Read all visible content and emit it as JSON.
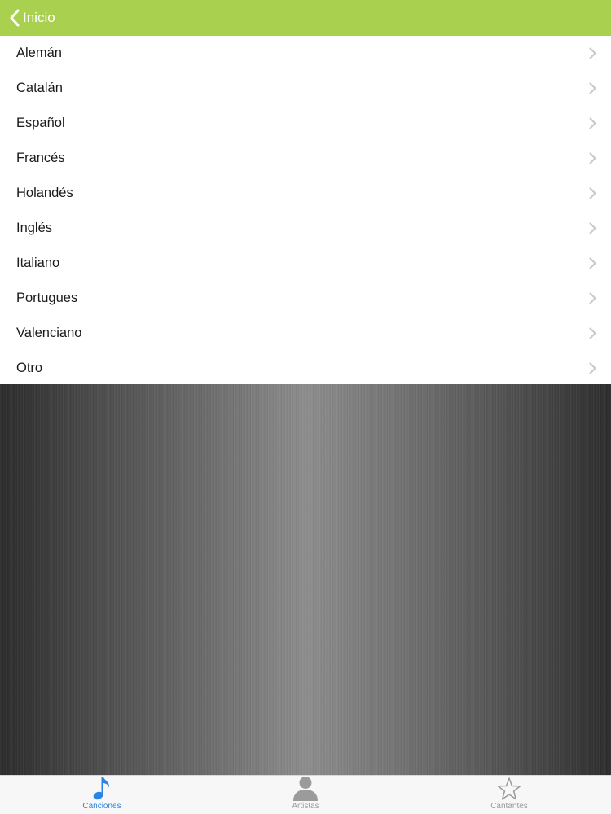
{
  "navbar": {
    "back_label": "Inicio",
    "back_icon": "chevron-left-icon",
    "background": "#a9d04f"
  },
  "languages": [
    {
      "label": "Alemán"
    },
    {
      "label": "Catalán"
    },
    {
      "label": "Español"
    },
    {
      "label": "Francés"
    },
    {
      "label": "Holandés"
    },
    {
      "label": "Inglés"
    },
    {
      "label": "Italiano"
    },
    {
      "label": "Portugues"
    },
    {
      "label": "Valenciano"
    },
    {
      "label": "Otro"
    }
  ],
  "row_icon": "chevron-right-icon",
  "tabbar": {
    "tabs": [
      {
        "label": "Canciones",
        "icon": "music-note-icon",
        "active": true
      },
      {
        "label": "Artistas",
        "icon": "person-icon",
        "active": false
      },
      {
        "label": "Cantantes",
        "icon": "star-icon",
        "active": false
      }
    ],
    "active_color": "#2a84e8",
    "inactive_color": "#9b9b9b"
  }
}
